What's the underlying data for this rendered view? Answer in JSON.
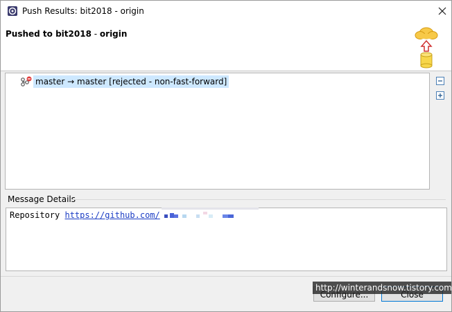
{
  "window": {
    "title": "Push Results: bit2018 - origin"
  },
  "header": {
    "branch": "Pushed to bit2018",
    "separator": " - ",
    "remote": "origin"
  },
  "results_tree": {
    "rows": [
      {
        "label": "master → master [rejected - non-fast-forward]",
        "icon": "ref-rejected-icon"
      }
    ],
    "collapse_all_icon": "collapse-all-icon",
    "expand_all_icon": "expand-all-icon",
    "selected_row_color": "#cde8ff"
  },
  "message_details": {
    "label": "Message Details",
    "repository_label": "Repository",
    "repository_url": "https://github.com/"
  },
  "buttons": {
    "configure": "Configure...",
    "close": "Close"
  },
  "watermark": "http://winterandsnow.tistory.com",
  "colors": {
    "link": "#1a3cc4",
    "default_button_border": "#0078d7",
    "dialog_background": "#f0f0f0"
  }
}
